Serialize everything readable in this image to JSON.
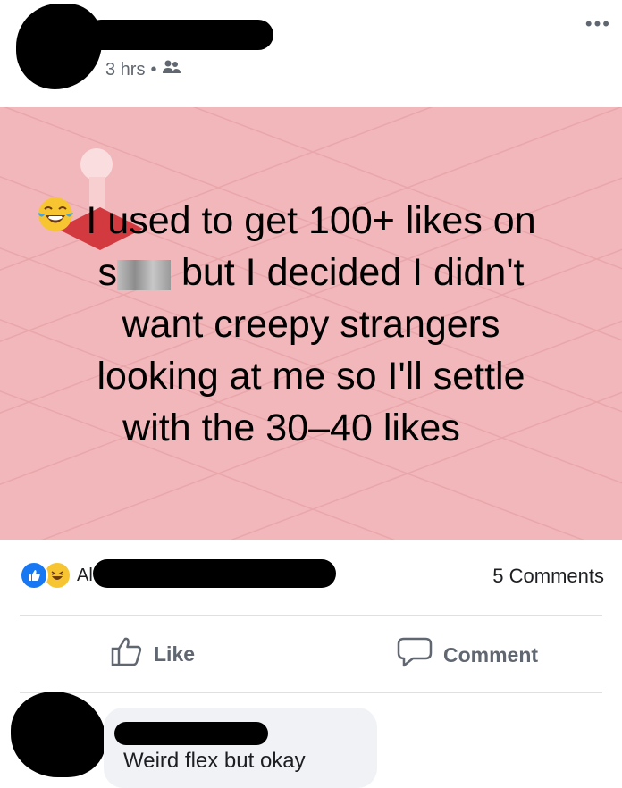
{
  "post": {
    "time": "3 hrs",
    "separator": "•",
    "audience_icon": "friends-icon",
    "more_label": "•••",
    "text_line1": "I used to get 100+ likes on",
    "text_line2_start": "s",
    "text_line2_end": " but I decided I didn't",
    "text_line3": "want creepy strangers",
    "text_line4": "looking at me so I'll settle",
    "text_line5": "with the 30–40 likes",
    "emoji_icon": "tears-of-joy-icon",
    "background_color": "#f2b7bb"
  },
  "reactions": {
    "icons": [
      "like-icon",
      "haha-icon"
    ],
    "names_partial": "Al"
  },
  "comments_count": "5 Comments",
  "actions": {
    "like_label": "Like",
    "comment_label": "Comment"
  },
  "comment": {
    "text": "Weird flex but okay"
  }
}
